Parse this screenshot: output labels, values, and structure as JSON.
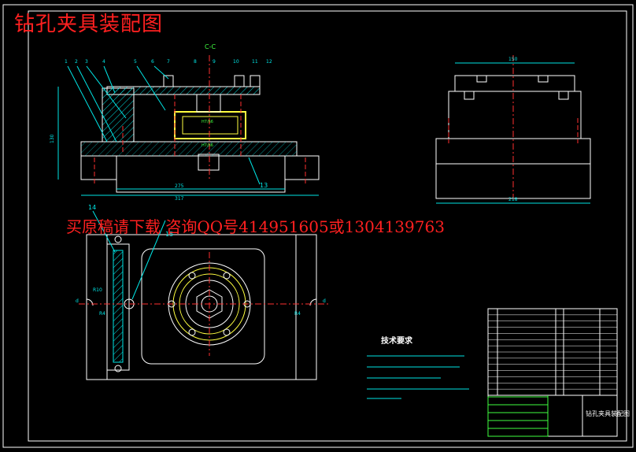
{
  "drawing": {
    "title": "钻孔夹具装配图",
    "watermark": "买原稿请下载 咨询QQ号414951605或1304139763",
    "section_label": "C-C",
    "tech_requirements_title": "技术要求",
    "title_block_name": "钻孔夹具装配图"
  },
  "part_numbers": [
    "1",
    "2",
    "3",
    "4",
    "5",
    "6",
    "7",
    "8",
    "9",
    "10",
    "11",
    "12"
  ],
  "callouts": {
    "c13": "13",
    "c14": "14",
    "c15": "15"
  },
  "dimensions": {
    "height_left": "130",
    "inner_width": "275",
    "overall_width": "317",
    "side_top": "150",
    "side_bottom": "218"
  },
  "fits": {
    "fit_upper": "H7/h6",
    "fit_lower": "H7/h6"
  },
  "plan_labels": {
    "r_top": "R10",
    "r_left": "R4",
    "r_right": "R4",
    "d_left": "d",
    "d_right": "d"
  },
  "colors": {
    "outline": "#ffffff",
    "hatch": "#00e5e5",
    "center": "#ff3030",
    "part": "#ffff40",
    "green": "#40ff40",
    "border": "#ffffff",
    "accent": "#ff3030"
  }
}
